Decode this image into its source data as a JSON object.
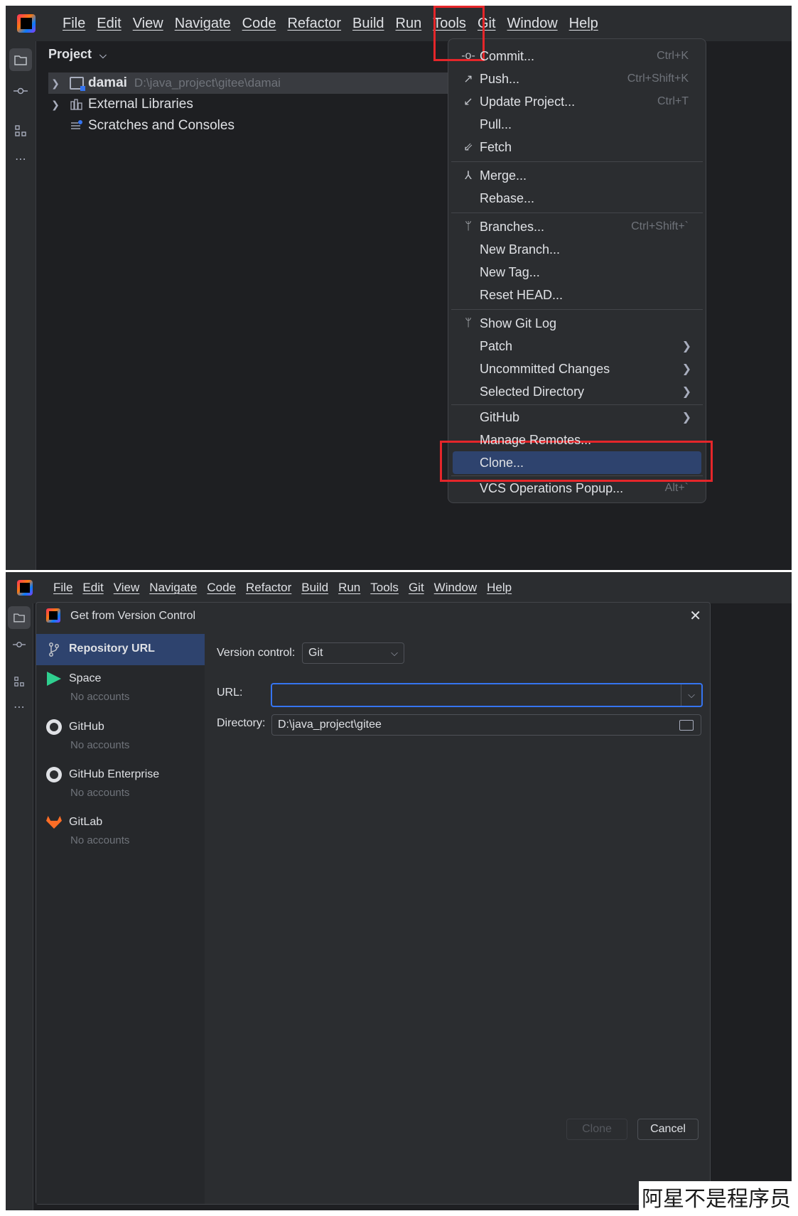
{
  "top": {
    "menubar": [
      "File",
      "Edit",
      "View",
      "Navigate",
      "Code",
      "Refactor",
      "Build",
      "Run",
      "Tools",
      "Git",
      "Window",
      "Help"
    ],
    "project_header": "Project",
    "tree": [
      {
        "name": "damai",
        "path": "D:\\java_project\\gitee\\damai"
      },
      {
        "name": "External Libraries"
      },
      {
        "name": "Scratches and Consoles"
      }
    ],
    "git_menu": [
      {
        "label": "Commit...",
        "shortcut": "Ctrl+K",
        "icon": "commit-icon"
      },
      {
        "label": "Push...",
        "shortcut": "Ctrl+Shift+K",
        "icon": "push-arrow-icon"
      },
      {
        "label": "Update Project...",
        "shortcut": "Ctrl+T",
        "icon": "update-arrow-icon"
      },
      {
        "label": "Pull...",
        "shortcut": "",
        "icon": ""
      },
      {
        "label": "Fetch",
        "shortcut": "",
        "icon": "fetch-icon"
      },
      {
        "label": "Merge...",
        "shortcut": "",
        "icon": "merge-icon"
      },
      {
        "label": "Rebase...",
        "shortcut": "",
        "icon": ""
      },
      {
        "label": "Branches...",
        "shortcut": "Ctrl+Shift+`",
        "icon": "branch-icon"
      },
      {
        "label": "New Branch...",
        "shortcut": "",
        "icon": ""
      },
      {
        "label": "New Tag...",
        "shortcut": "",
        "icon": ""
      },
      {
        "label": "Reset HEAD...",
        "shortcut": "",
        "icon": ""
      },
      {
        "label": "Show Git Log",
        "shortcut": "",
        "icon": "git-log-icon"
      },
      {
        "label": "Patch",
        "shortcut": "",
        "icon": "",
        "submenu": true
      },
      {
        "label": "Uncommitted Changes",
        "shortcut": "",
        "icon": "",
        "submenu": true
      },
      {
        "label": "Selected Directory",
        "shortcut": "",
        "icon": "",
        "submenu": true
      },
      {
        "label": "GitHub",
        "shortcut": "",
        "icon": "",
        "submenu": true
      },
      {
        "label": "Manage Remotes...",
        "shortcut": "",
        "icon": ""
      },
      {
        "label": "Clone...",
        "shortcut": "",
        "icon": "",
        "highlighted": true
      },
      {
        "label": "VCS Operations Popup...",
        "shortcut": "Alt+`",
        "icon": ""
      }
    ]
  },
  "bottom": {
    "menubar": [
      "File",
      "Edit",
      "View",
      "Navigate",
      "Code",
      "Refactor",
      "Build",
      "Run",
      "Tools",
      "Git",
      "Window",
      "Help"
    ],
    "dialog_title": "Get from Version Control",
    "sidebar": [
      {
        "name": "Repository URL",
        "sub": ""
      },
      {
        "name": "Space",
        "sub": "No accounts"
      },
      {
        "name": "GitHub",
        "sub": "No accounts"
      },
      {
        "name": "GitHub Enterprise",
        "sub": "No accounts"
      },
      {
        "name": "GitLab",
        "sub": "No accounts"
      }
    ],
    "version_control_label": "Version control:",
    "version_control_value": "Git",
    "url_label": "URL:",
    "url_value": "",
    "directory_label": "Directory:",
    "directory_value": "D:\\java_project\\gitee",
    "clone_button": "Clone",
    "cancel_button": "Cancel"
  },
  "watermark": "阿星不是程序员",
  "colors": {
    "highlight": "#2e436e",
    "accent": "#3574f0",
    "annotation_red": "#e5262a"
  }
}
